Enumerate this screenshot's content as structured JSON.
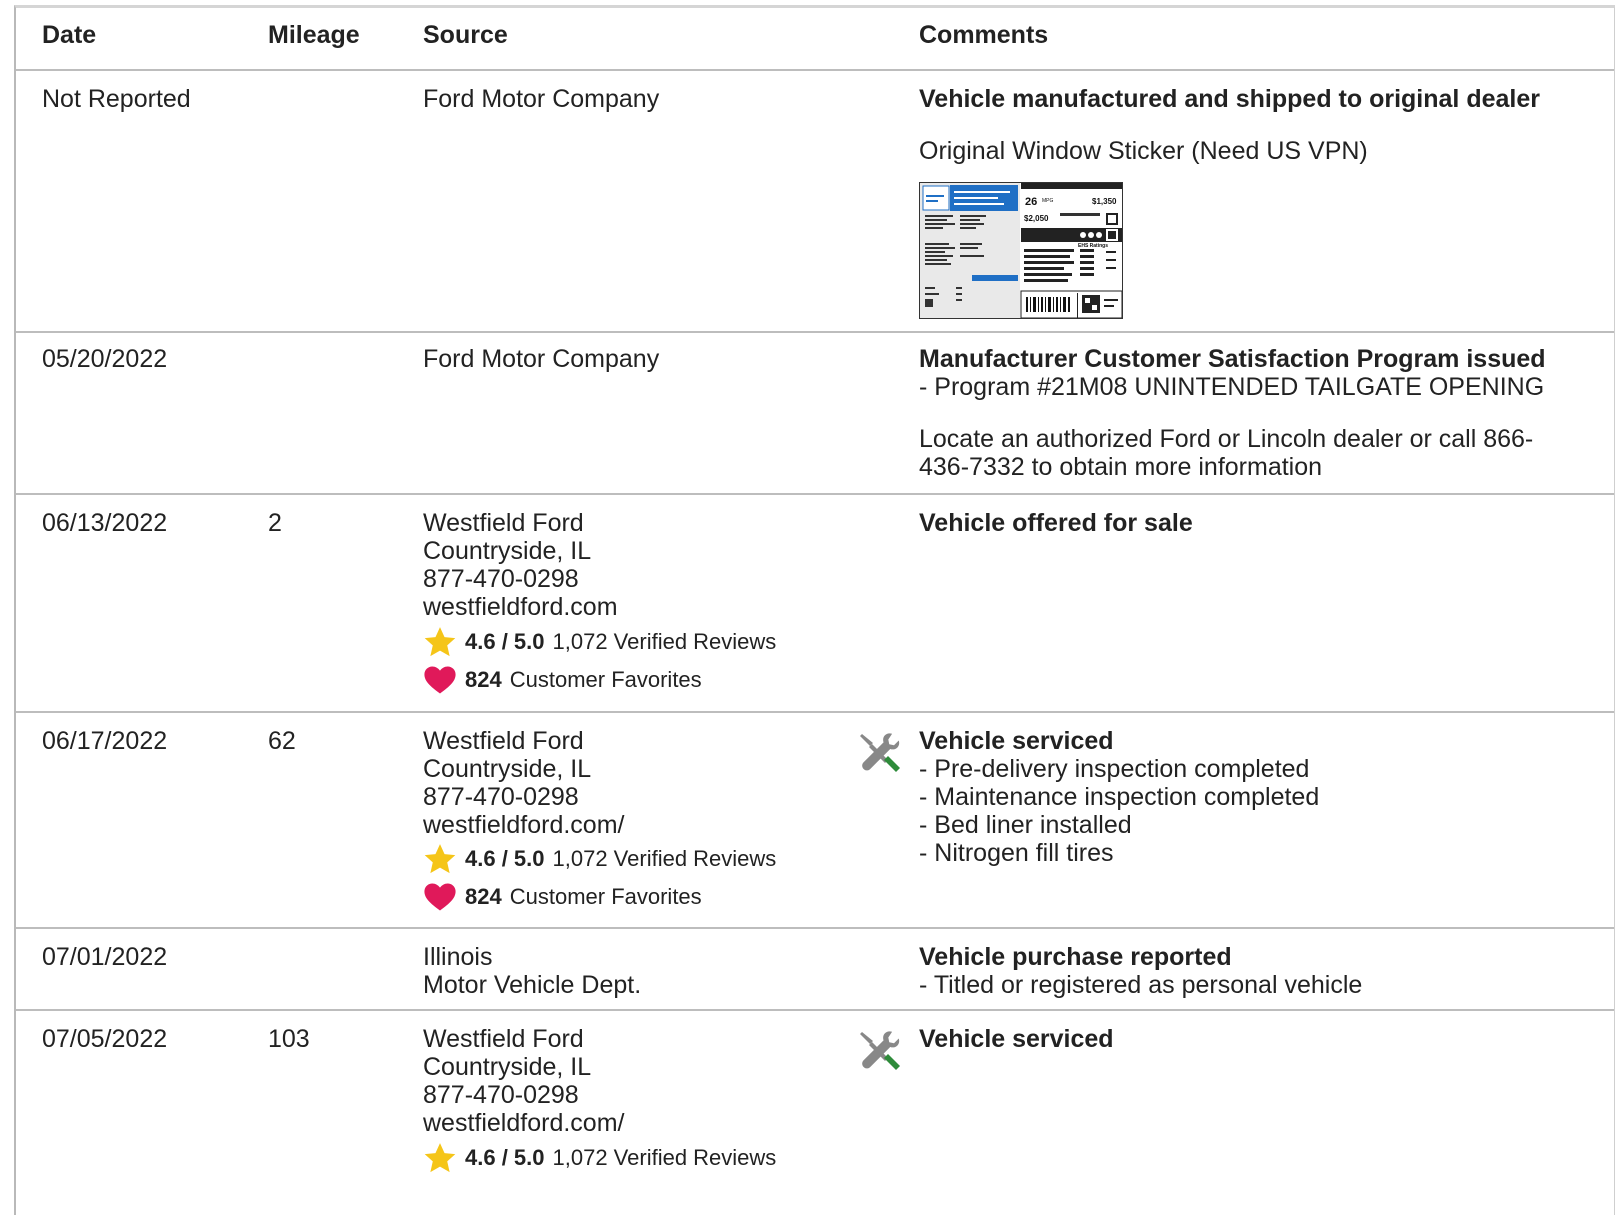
{
  "table": {
    "headers": {
      "date": "Date",
      "mileage": "Mileage",
      "source": "Source",
      "comments": "Comments"
    },
    "rows": [
      {
        "date": "Not Reported",
        "mileage": "",
        "source": [
          "Ford Motor Company"
        ],
        "comment_title": "Vehicle manufactured and shipped to original dealer",
        "comment_text": "Original Window Sticker (Need US VPN)",
        "sticker": {
          "mpg": "26",
          "mpg_unit": "MPG",
          "price_a": "$2,050",
          "price_b": "$1,350",
          "label": "EHS Ratings"
        }
      },
      {
        "date": "05/20/2022",
        "mileage": "",
        "source": [
          "Ford Motor Company"
        ],
        "comment_title": "Manufacturer Customer Satisfaction Program issued",
        "comment_items": [
          "Program #21M08 UNINTENDED TAILGATE OPENING"
        ],
        "comment_text": "Locate an authorized Ford or Lincoln dealer or call 866-436-7332 to obtain more information"
      },
      {
        "date": "06/13/2022",
        "mileage": "2",
        "source": [
          "Westfield Ford",
          "Countryside, IL",
          "877-470-0298",
          "westfieldford.com"
        ],
        "rating": {
          "score": "4.6 / 5.0",
          "reviews": "1,072 Verified Reviews"
        },
        "favorites": {
          "count": "824",
          "label": "Customer Favorites"
        },
        "comment_title": "Vehicle offered for sale"
      },
      {
        "date": "06/17/2022",
        "mileage": "62",
        "source": [
          "Westfield Ford",
          "Countryside, IL",
          "877-470-0298",
          "westfieldford.com/"
        ],
        "rating": {
          "score": "4.6 / 5.0",
          "reviews": "1,072 Verified Reviews"
        },
        "favorites": {
          "count": "824",
          "label": "Customer Favorites"
        },
        "service_icon": "wrench-screwdriver-icon",
        "comment_title": "Vehicle serviced",
        "comment_items": [
          "Pre-delivery inspection completed",
          "Maintenance inspection completed",
          "Bed liner installed",
          "Nitrogen fill tires"
        ]
      },
      {
        "date": "07/01/2022",
        "mileage": "",
        "source": [
          "Illinois",
          "Motor Vehicle Dept."
        ],
        "comment_title": "Vehicle purchase reported",
        "comment_items": [
          "Titled or registered as personal vehicle"
        ]
      },
      {
        "date": "07/05/2022",
        "mileage": "103",
        "source": [
          "Westfield Ford",
          "Countryside, IL",
          "877-470-0298",
          "westfieldford.com/"
        ],
        "rating": {
          "score": "4.6 / 5.0",
          "reviews": "1,072 Verified Reviews"
        },
        "service_icon": "wrench-screwdriver-icon",
        "comment_title": "Vehicle serviced"
      }
    ]
  },
  "colors": {
    "star": "#f5c518",
    "heart": "#e0195a",
    "tool_gray": "#888888",
    "tool_green": "#2e8b3a",
    "sticker_blue": "#1f6fc5",
    "divider": "#bdbdbd"
  },
  "icons": {
    "star": "star-icon",
    "heart": "heart-icon",
    "service": "wrench-screwdriver-icon"
  }
}
